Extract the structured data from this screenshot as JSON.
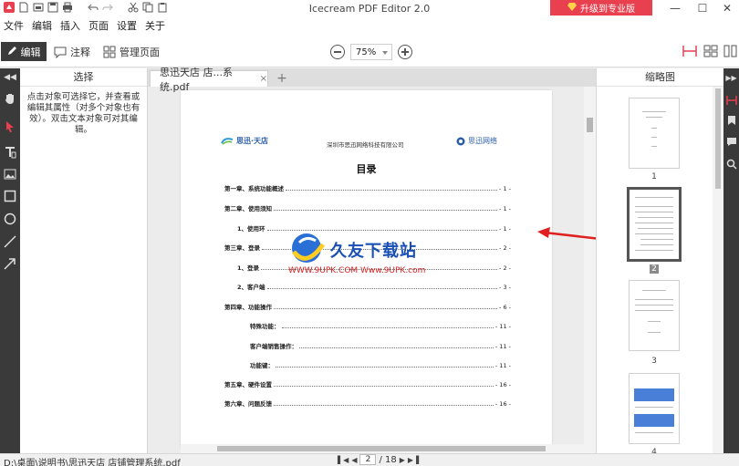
{
  "window": {
    "title": "Icecream PDF Editor 2.0",
    "upgrade_label": "升级到专业版",
    "minimize": "—",
    "maximize": "☐",
    "close": "✕"
  },
  "menu": {
    "items": [
      "文件",
      "编辑",
      "插入",
      "页面",
      "设置",
      "关于"
    ]
  },
  "toolbar": {
    "edit_label": "编辑",
    "annotate_label": "注释",
    "manage_pages_label": "管理页面",
    "zoom_value": "75%"
  },
  "left_panel": {
    "header": "选择",
    "hint": "点击对象可选择它，并查看或编辑其属性（对多个对象也有效）。双击文本对象可对其编辑。"
  },
  "tab": {
    "filename": "思迅天店 店...系统.pdf",
    "close": "×",
    "add": "+"
  },
  "page": {
    "logo_left": "思迅·天店",
    "center_title": "深圳市思迅网络科技有限公司",
    "logo_right": "思迅网络",
    "toc_title": "目录",
    "toc": [
      {
        "label": "第一章、系统功能概述",
        "page": "- 1 -"
      },
      {
        "label": "第二章、使用须知",
        "page": "- 1 -"
      },
      {
        "label": "1、使用环",
        "page": "- 1 -"
      },
      {
        "label": "第三章、登录",
        "page": "- 2 -"
      },
      {
        "label": "1、登录",
        "page": "- 2 -"
      },
      {
        "label": "2、客户端",
        "page": "- 3 -"
      },
      {
        "label": "第四章、功能操作",
        "page": "- 6 -"
      },
      {
        "label": "特殊功能：",
        "page": "- 11 -"
      },
      {
        "label": "客户端销售操作：",
        "page": "- 11 -"
      },
      {
        "label": "功能键：",
        "page": "- 11 -"
      },
      {
        "label": "第五章、硬件设置",
        "page": "- 16 -"
      },
      {
        "label": "第六章、问题反馈",
        "page": "- 16 -"
      }
    ],
    "watermark_text": "久友下载站",
    "watermark_sub": "WWW.9UPK.COM  Www.9UPK.com"
  },
  "thumbnails": {
    "header": "缩略图",
    "pages": [
      "1",
      "2",
      "3",
      "4"
    ]
  },
  "status": {
    "path": "D:\\桌面\\说明书\\思迅天店 店铺管理系统.pdf",
    "current_page": "2",
    "total_pages": "/ 18"
  },
  "colors": {
    "accent_red": "#e8404e",
    "rail_dark": "#3a3a3a",
    "tool_active": "#e8404e"
  }
}
